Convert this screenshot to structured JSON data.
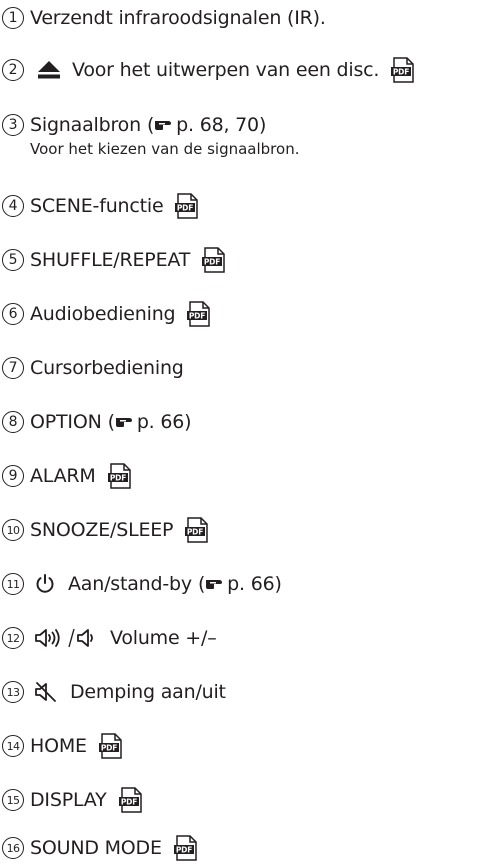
{
  "items": [
    {
      "num": "1",
      "text": "Verzendt infraroodsignalen (IR)."
    },
    {
      "num": "2",
      "symbol": "eject-icon",
      "text": "Voor het uitwerpen van een disc.",
      "pdf": true
    },
    {
      "num": "3",
      "text": "Signaalbron",
      "ref": "p. 68, 70",
      "desc": "Voor het kiezen van de signaalbron."
    },
    {
      "num": "4",
      "text": "SCENE-functie",
      "pdf": true
    },
    {
      "num": "5",
      "text": "SHUFFLE/REPEAT",
      "pdf": true
    },
    {
      "num": "6",
      "text": "Audiobediening",
      "pdf": true
    },
    {
      "num": "7",
      "text": "Cursorbediening"
    },
    {
      "num": "8",
      "text": "OPTION",
      "ref": "p. 66"
    },
    {
      "num": "9",
      "text": "ALARM",
      "pdf": true
    },
    {
      "num": "10",
      "text": "SNOOZE/SLEEP",
      "pdf": true
    },
    {
      "num": "11",
      "symbol": "power-icon",
      "text": "Aan/stand-by",
      "ref": "p. 66"
    },
    {
      "num": "12",
      "symbol": "volume-icon",
      "text": "Volume +/–"
    },
    {
      "num": "13",
      "symbol": "mute-icon",
      "text": "Demping aan/uit"
    },
    {
      "num": "14",
      "text": "HOME",
      "pdf": true
    },
    {
      "num": "15",
      "text": "DISPLAY",
      "pdf": true
    },
    {
      "num": "16",
      "text": "SOUND MODE",
      "pdf": true
    }
  ],
  "pdf_icon_label": "PDF",
  "colors": {
    "text": "#231f20",
    "pdf_dark": "#231f20"
  }
}
